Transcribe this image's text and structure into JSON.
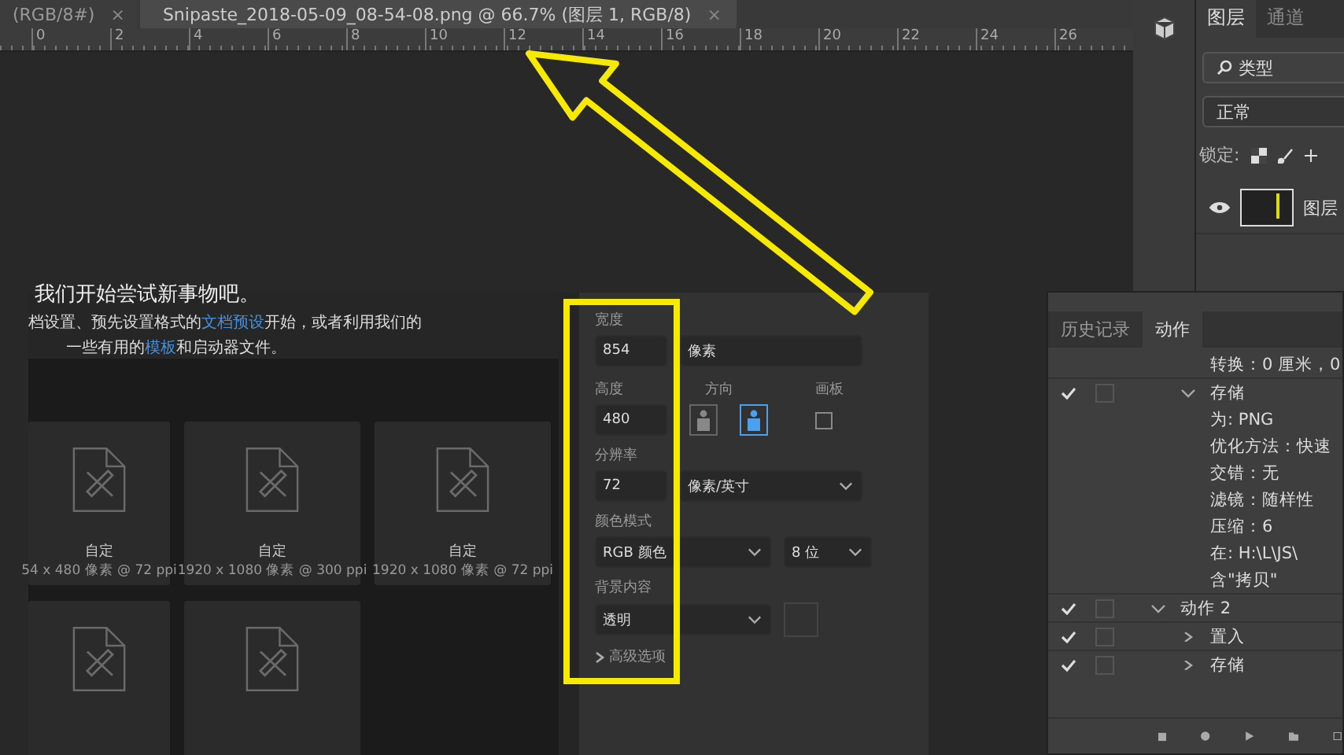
{
  "document_tabs": [
    {
      "label": "(RGB/8#)",
      "close": "×",
      "selected": false
    },
    {
      "label": "Snipaste_2018-05-09_08-54-08.png @ 66.7% (图层 1, RGB/8)",
      "close": "×",
      "selected": true
    }
  ],
  "ruler": [
    "0",
    "2",
    "4",
    "6",
    "8",
    "10",
    "12",
    "14",
    "16",
    "18",
    "20",
    "22",
    "24",
    "26"
  ],
  "new_document": {
    "heading": "我们开始尝试新事物吧。",
    "intro": [
      [
        {
          "text": "档设置、预先设置格式的",
          "link": false
        },
        {
          "text": "文档预设",
          "link": true
        },
        {
          "text": "开始，或者利用我们的",
          "link": false
        }
      ],
      [
        {
          "text": "一些有用的",
          "link": false
        },
        {
          "text": "模板",
          "link": true
        },
        {
          "text": "和启动器文件。",
          "link": false
        }
      ]
    ],
    "presets": [
      {
        "kind": "labeled",
        "name": "自定",
        "size": "54 x 480 像素 @ 72 ppi"
      },
      {
        "kind": "labeled",
        "name": "自定",
        "size": "1920 x 1080 像素 @ 300 ppi"
      },
      {
        "kind": "labeled",
        "name": "自定",
        "size": "1920 x 1080 像素 @ 72 ppi"
      },
      {
        "kind": "blank"
      },
      {
        "kind": "blank"
      }
    ],
    "details": {
      "width": {
        "label": "宽度",
        "value": "854",
        "unit": "像素"
      },
      "height": {
        "label": "高度",
        "value": "480"
      },
      "orientation": {
        "label": "方向",
        "options": [
          {
            "selected": false
          },
          {
            "selected": true
          }
        ]
      },
      "artboard": {
        "label": "画板",
        "checked": false
      },
      "resolution": {
        "label": "分辨率",
        "value": "72",
        "unit": "像素/英寸"
      },
      "color_mode": {
        "label": "颜色模式",
        "mode": "RGB 颜色",
        "depth": "8 位"
      },
      "background": {
        "label": "背景内容",
        "value": "透明"
      },
      "advanced": {
        "label": "高级选项",
        "expanded": false
      }
    }
  },
  "layers_panel": {
    "tabs": [
      {
        "label": "图层",
        "selected": true
      },
      {
        "label": "通道",
        "selected": false
      }
    ],
    "filter": "类型",
    "blend_mode": "正常",
    "lock_label": "锁定:",
    "layers": [
      {
        "name": "图层",
        "visible": true
      }
    ]
  },
  "actions_panel": {
    "tabs": [
      {
        "label": "历史记录",
        "selected": false
      },
      {
        "label": "动作",
        "selected": true
      }
    ],
    "items": [
      {
        "kind": "step",
        "text": "转换：0 厘米，0"
      },
      {
        "kind": "command",
        "text": "存储",
        "enabled": true,
        "expanded": true,
        "children": [
          {
            "text": "为: PNG"
          },
          {
            "text": "优化方法：快速"
          },
          {
            "text": "交错：无"
          },
          {
            "text": "滤镜：随样性"
          },
          {
            "text": "压缩：6"
          },
          {
            "text": "在: H:\\L\\JS\\"
          },
          {
            "text": "含\"拷贝\""
          }
        ]
      },
      {
        "kind": "action",
        "text": "动作 2",
        "enabled": true,
        "expanded": true,
        "children": [
          {
            "text": "置入",
            "enabled": true,
            "expanded": false
          },
          {
            "text": "存储",
            "enabled": true,
            "expanded": false
          }
        ]
      }
    ]
  }
}
